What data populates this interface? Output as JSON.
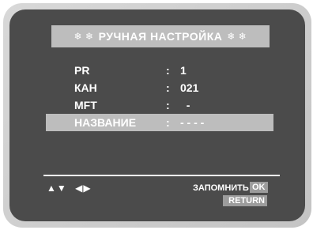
{
  "title": {
    "stars_left": "❄ ❄",
    "text": "РУЧНАЯ НАСТРОЙКА",
    "stars_right": "❄ ❄"
  },
  "menu": [
    {
      "label": "PR",
      "colon": ":",
      "value": "1"
    },
    {
      "label": "КАН",
      "colon": ":",
      "value": "021"
    },
    {
      "label": "MFT",
      "colon": ":",
      "value": "  -"
    },
    {
      "label": "НАЗВАНИЕ",
      "colon": ":",
      "value": "- - - -"
    }
  ],
  "footer": {
    "nav_updown": "▲▼",
    "nav_leftright": "◀▶",
    "store_label": "ЗАПОМНИТЬ :",
    "ok_key": "OK",
    "return_key": "RETURN"
  },
  "colors": {
    "screen": "#4b4b4b",
    "highlight": "#bdbdbd",
    "text": "#ffffff"
  }
}
